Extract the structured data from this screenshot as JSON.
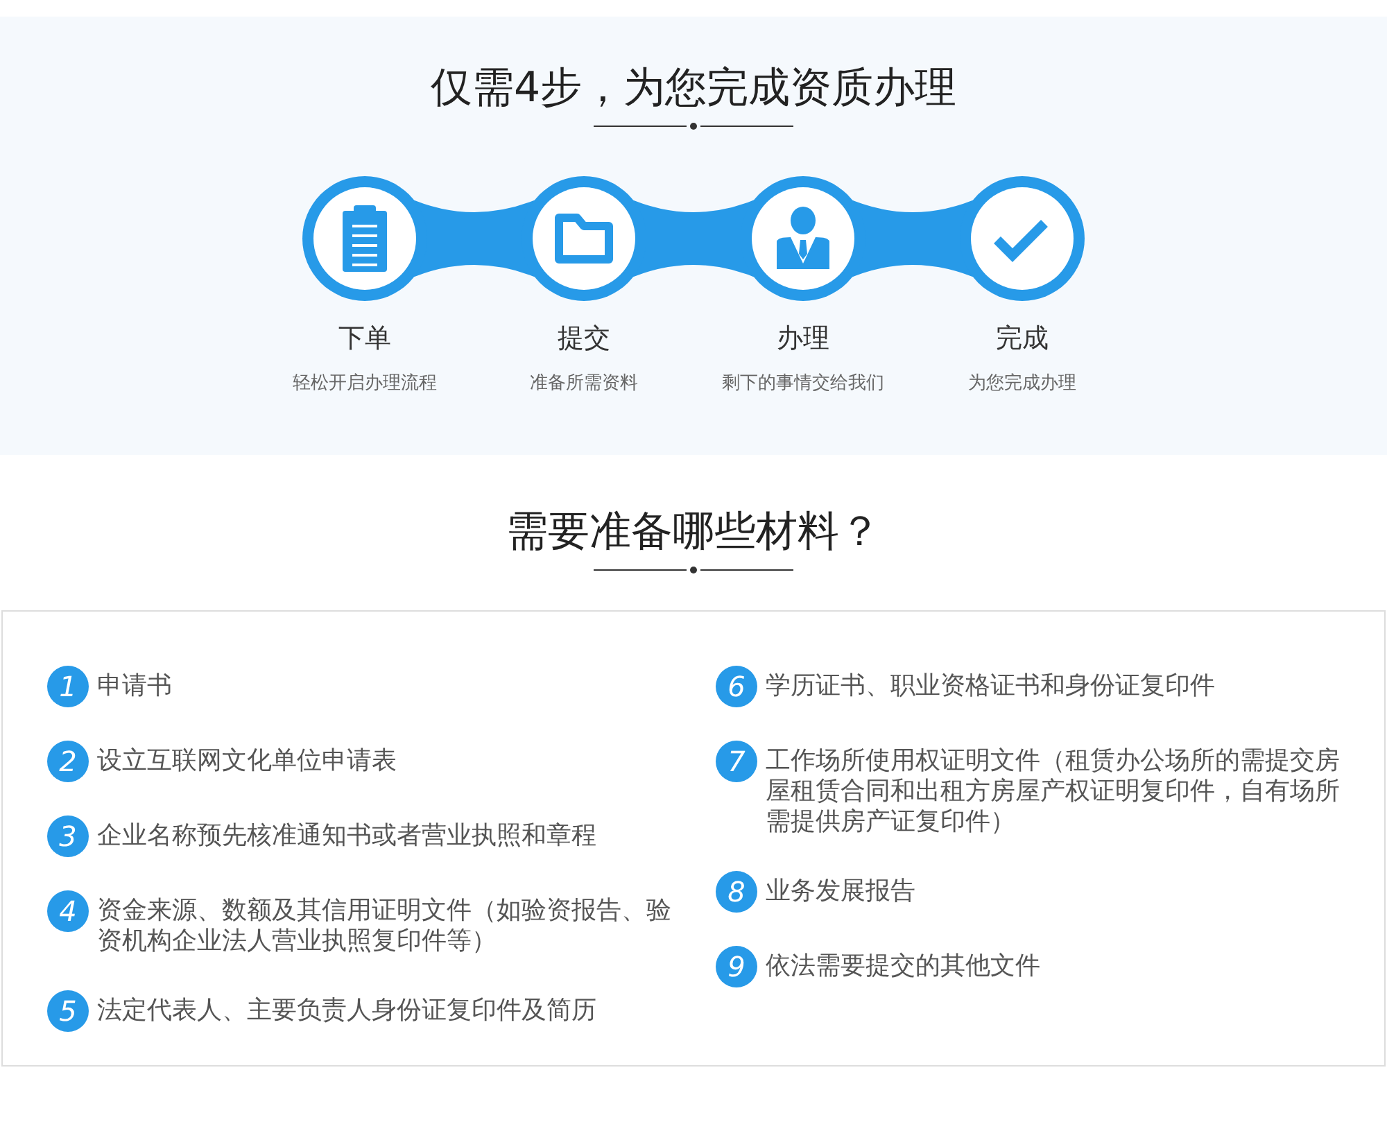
{
  "process": {
    "title": "仅需4步，为您完成资质办理",
    "steps": [
      {
        "kind": "clipboard",
        "title": "下单",
        "subtitle": "轻松开启办理流程"
      },
      {
        "kind": "folder",
        "title": "提交",
        "subtitle": "准备所需资料"
      },
      {
        "kind": "person",
        "title": "办理",
        "subtitle": "剩下的事情交给我们"
      },
      {
        "kind": "check",
        "title": "完成",
        "subtitle": "为您完成办理"
      }
    ]
  },
  "materials": {
    "title": "需要准备哪些材料？",
    "left": [
      {
        "number": "1",
        "text": "申请书"
      },
      {
        "number": "2",
        "text": "设立互联网文化单位申请表"
      },
      {
        "number": "3",
        "text": "企业名称预先核准通知书或者营业执照和章程"
      },
      {
        "number": "4",
        "text": "资金来源、数额及其信用证明文件（如验资报告、验资机构企业法人营业执照复印件等）"
      },
      {
        "number": "5",
        "text": "法定代表人、主要负责人身份证复印件及简历"
      }
    ],
    "right": [
      {
        "number": "6",
        "text": "学历证书、职业资格证书和身份证复印件"
      },
      {
        "number": "7",
        "text": "工作场所使用权证明文件（租赁办公场所的需提交房屋租赁合同和出租方房屋产权证明复印件，自有场所需提供房产证复印件）"
      },
      {
        "number": "8",
        "text": "业务发展报告"
      },
      {
        "number": "9",
        "text": "依法需要提交的其他文件"
      }
    ]
  }
}
